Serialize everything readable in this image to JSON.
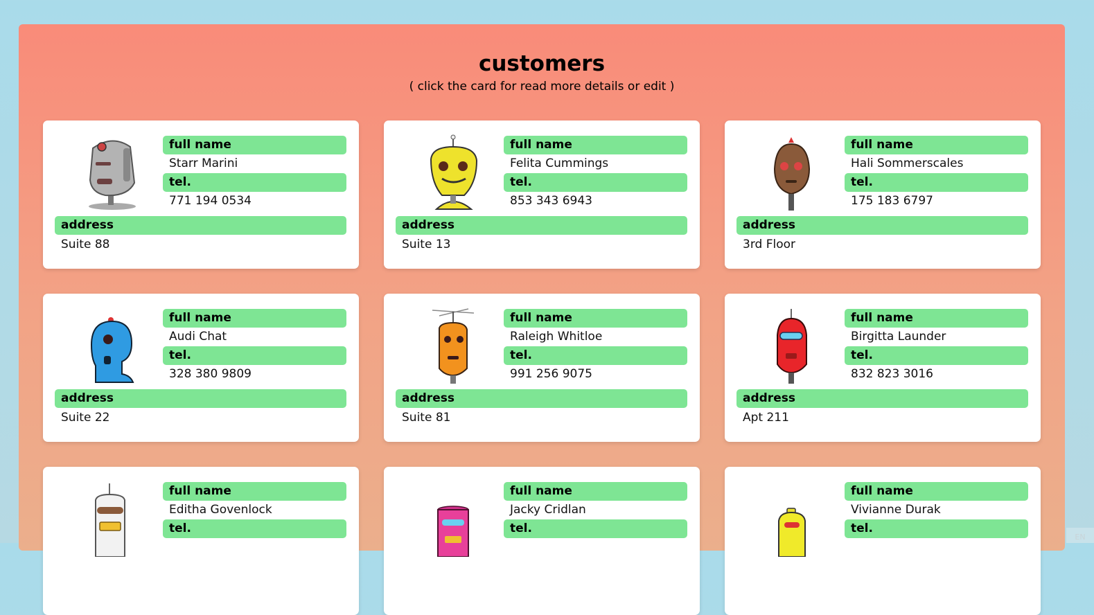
{
  "page": {
    "title": "customers",
    "subtitle": "( click the card for read more details or edit )",
    "lang_badge": "EN"
  },
  "field_labels": {
    "name": "full name",
    "tel": "tel.",
    "address": "address"
  },
  "colors": {
    "label_bg": "#7ee594",
    "panel_top": "#f98b79",
    "panel_bottom": "#ebaf8c",
    "page_bg": "#a9dbea"
  },
  "customers": [
    {
      "name": "Starr Marini",
      "tel": "771 194 0534",
      "address": "Suite 88",
      "avatar": "grey-robot-icon"
    },
    {
      "name": "Felita Cummings",
      "tel": "853 343 6943",
      "address": "Suite 13",
      "avatar": "yellow-robot-icon"
    },
    {
      "name": "Hali Sommerscales",
      "tel": "175 183 6797",
      "address": "3rd Floor",
      "avatar": "brown-robot-icon"
    },
    {
      "name": "Audi Chat",
      "tel": "328 380 9809",
      "address": "Suite 22",
      "avatar": "blue-robot-icon"
    },
    {
      "name": "Raleigh Whitloe",
      "tel": "991 256 9075",
      "address": "Suite 81",
      "avatar": "orange-robot-icon"
    },
    {
      "name": "Birgitta Launder",
      "tel": "832 823 3016",
      "address": "Apt 211",
      "avatar": "red-robot-icon"
    },
    {
      "name": "Editha Govenlock",
      "tel": "",
      "address": "",
      "avatar": "white-robot-icon"
    },
    {
      "name": "Jacky Cridlan",
      "tel": "",
      "address": "",
      "avatar": "pink-robot-icon"
    },
    {
      "name": "Vivianne Durak",
      "tel": "",
      "address": "",
      "avatar": "yellow-robot-icon"
    }
  ]
}
